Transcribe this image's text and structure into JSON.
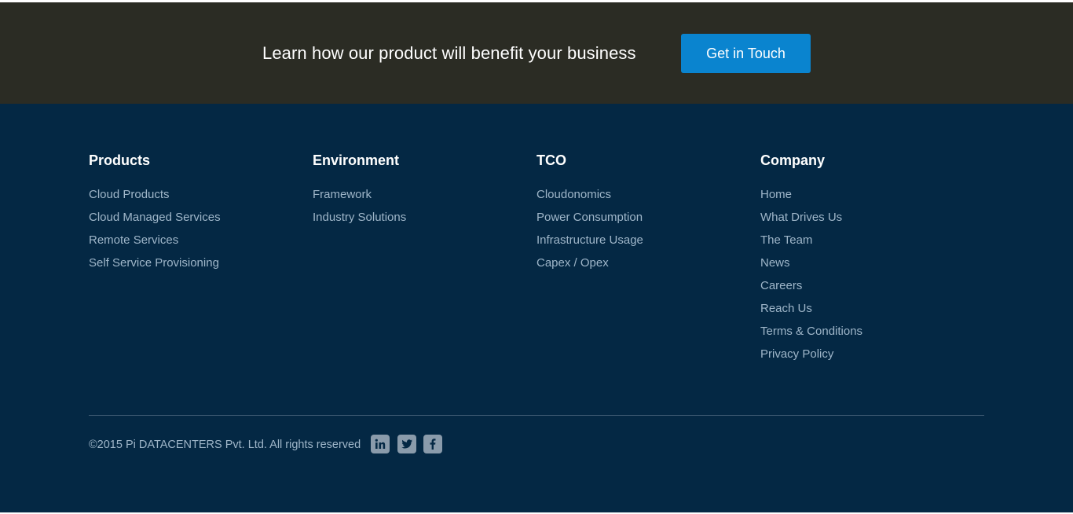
{
  "cta": {
    "text": "Learn how our product will benefit your business",
    "button_label": "Get in Touch"
  },
  "footer": {
    "columns": [
      {
        "title": "Products",
        "links": [
          "Cloud Products",
          "Cloud Managed Services",
          "Remote Services",
          "Self Service Provisioning"
        ]
      },
      {
        "title": "Environment",
        "links": [
          "Framework",
          "Industry Solutions"
        ]
      },
      {
        "title": "TCO",
        "links": [
          "Cloudonomics",
          "Power Consumption",
          "Infrastructure Usage",
          "Capex / Opex"
        ]
      },
      {
        "title": "Company",
        "links": [
          "Home",
          "What Drives Us",
          "The Team",
          "News",
          "Careers",
          "Reach Us",
          "Terms & Conditions",
          "Privacy Policy"
        ]
      }
    ],
    "copyright": "©2015 Pi DATACENTERS Pvt. Ltd. All rights reserved",
    "social_icons": [
      "linkedin-icon",
      "twitter-icon",
      "facebook-icon"
    ]
  },
  "colors": {
    "cta_background": "#2b2c24",
    "button_blue": "#0a84cf",
    "footer_background": "#042844",
    "link_color": "#9fb6c9",
    "social_icon_bg": "#8a9bab"
  }
}
